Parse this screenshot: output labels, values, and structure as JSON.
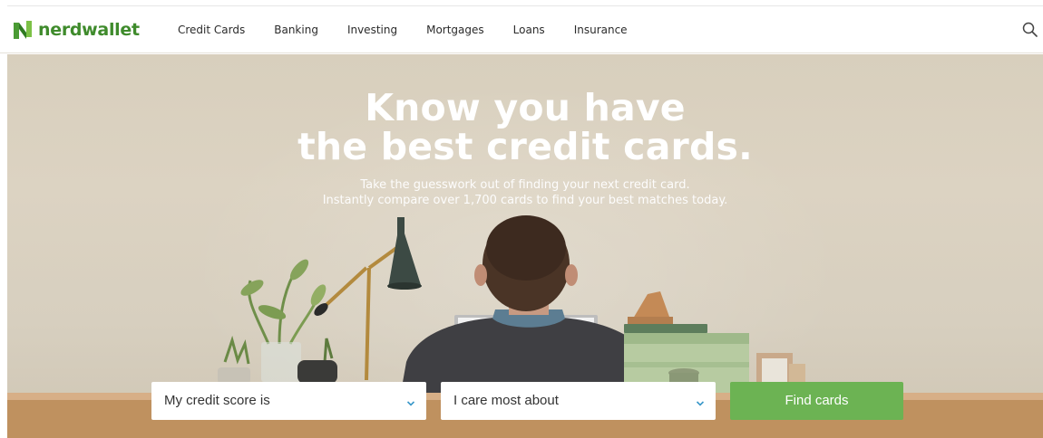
{
  "header": {
    "logo_text": "nerdwallet",
    "nav": [
      "Credit Cards",
      "Banking",
      "Investing",
      "Mortgages",
      "Loans",
      "Insurance"
    ]
  },
  "hero": {
    "headline_line1": "Know you have",
    "headline_line2": "the best credit cards.",
    "sub_line1": "Take the guesswork out of finding your next credit card.",
    "sub_line2": "Instantly compare over 1,700 cards to find your best matches today."
  },
  "form": {
    "credit_score_label": "My credit score is",
    "care_most_label": "I care most about",
    "find_button": "Find cards"
  },
  "colors": {
    "brand_green": "#3f8b2c",
    "button_green": "#6cb353",
    "chevron_blue": "#3a98c9"
  },
  "icons": [
    "nerdwallet-logo-icon",
    "search-icon",
    "chevron-down-icon"
  ]
}
